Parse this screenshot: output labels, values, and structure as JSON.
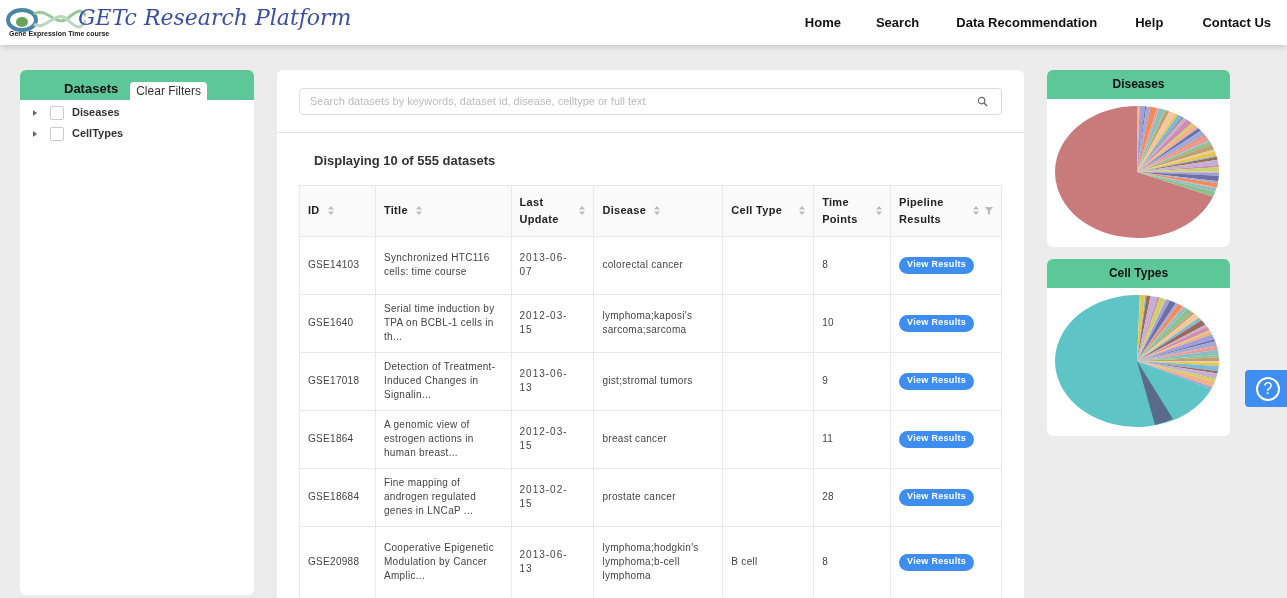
{
  "header": {
    "logo_title": "GETc Research Platform",
    "logo_subtitle": "Gene Expression Time course",
    "nav": [
      {
        "label": "Home"
      },
      {
        "label": "Search"
      },
      {
        "label": "Data Recommendation"
      },
      {
        "label": "Help"
      },
      {
        "label": "Contact Us"
      }
    ]
  },
  "sidebar": {
    "title": "Datasets",
    "clear_button": "Clear Filters",
    "items": [
      {
        "label": "Diseases",
        "checked": false,
        "expanded": false
      },
      {
        "label": "CellTypes",
        "checked": false,
        "expanded": false
      }
    ]
  },
  "search": {
    "placeholder": "Search datasets by keywords, dataset id, disease, celltype or full text"
  },
  "summary": "Displaying 10 of 555 datasets",
  "table": {
    "columns": [
      {
        "label": "ID",
        "sortable": true
      },
      {
        "label": "Title",
        "sortable": true
      },
      {
        "label": "Last Update",
        "sortable": true
      },
      {
        "label": "Disease",
        "sortable": true
      },
      {
        "label": "Cell Type",
        "sortable": true
      },
      {
        "label": "Time Points",
        "sortable": true
      },
      {
        "label": "Pipeline Results",
        "sortable": true,
        "filter": true
      }
    ],
    "rows": [
      {
        "id": "GSE14103",
        "title": "Synchronized HTC116 cells: time course",
        "last_update": "2013-06-07",
        "disease": "colorectal cancer",
        "cell_type": "",
        "time_points": "8",
        "action": "View Results"
      },
      {
        "id": "GSE1640",
        "title": "Serial time induction by TPA on BCBL-1 cells in th...",
        "last_update": "2012-03-15",
        "disease": "lymphoma;kaposi's sarcoma;sarcoma",
        "cell_type": "",
        "time_points": "10",
        "action": "View Results"
      },
      {
        "id": "GSE17018",
        "title": "Detection of Treatment-Induced Changes in Signalin...",
        "last_update": "2013-06-13",
        "disease": "gist;stromal tumors",
        "cell_type": "",
        "time_points": "9",
        "action": "View Results"
      },
      {
        "id": "GSE1864",
        "title": "A genomic view of estrogen actions in human breast...",
        "last_update": "2012-03-15",
        "disease": "breast cancer",
        "cell_type": "",
        "time_points": "11",
        "action": "View Results"
      },
      {
        "id": "GSE18684",
        "title": "Fine mapping of androgen regulated genes in LNCaP ...",
        "last_update": "2013-02-15",
        "disease": "prostate cancer",
        "cell_type": "",
        "time_points": "28",
        "action": "View Results"
      },
      {
        "id": "GSE20988",
        "title": "Cooperative Epigenetic Modulation by Cancer Amplic...",
        "last_update": "2013-06-13",
        "disease": "lymphoma;hodgkin's lymphoma;b-cell lymphoma",
        "cell_type": "B cell",
        "time_points": "8",
        "action": "View Results"
      }
    ]
  },
  "charts": [
    {
      "title": "Diseases",
      "kind": "picture"
    },
    {
      "title": "Cell Types",
      "kind": "picture"
    }
  ],
  "help_button": {
    "label": "?"
  }
}
